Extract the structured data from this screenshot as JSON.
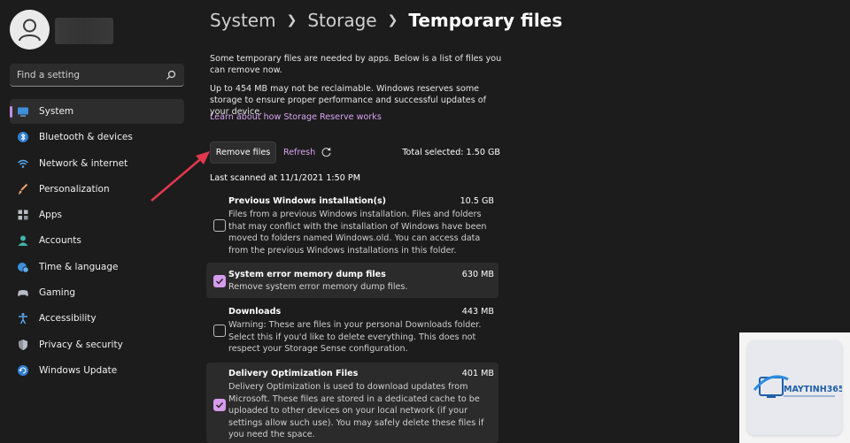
{
  "sidebar": {
    "search_placeholder": "Find a setting",
    "items": [
      {
        "label": "System",
        "icon": "monitor-icon"
      },
      {
        "label": "Bluetooth & devices",
        "icon": "bluetooth-icon"
      },
      {
        "label": "Network & internet",
        "icon": "wifi-icon"
      },
      {
        "label": "Personalization",
        "icon": "brush-icon"
      },
      {
        "label": "Apps",
        "icon": "apps-icon"
      },
      {
        "label": "Accounts",
        "icon": "person-icon"
      },
      {
        "label": "Time & language",
        "icon": "globe-clock-icon"
      },
      {
        "label": "Gaming",
        "icon": "gamepad-icon"
      },
      {
        "label": "Accessibility",
        "icon": "accessibility-icon"
      },
      {
        "label": "Privacy & security",
        "icon": "shield-icon"
      },
      {
        "label": "Windows Update",
        "icon": "update-icon"
      }
    ]
  },
  "breadcrumb": {
    "root": "System",
    "middle": "Storage",
    "current": "Temporary files"
  },
  "intro_text": "Some temporary files are needed by apps. Below is a list of files you can remove now.",
  "reserve_text": "Up to 454 MB may not be reclaimable. Windows reserves some storage to ensure proper performance and successful updates of your device.",
  "learn_link": "Learn about how Storage Reserve works",
  "actions": {
    "remove_label": "Remove files",
    "refresh_label": "Refresh",
    "total_selected": "Total selected: 1.50 GB"
  },
  "last_scanned": "Last scanned at 11/1/2021 1:50 PM",
  "files": [
    {
      "title": "Previous Windows installation(s)",
      "size": "10.5 GB",
      "checked": false,
      "desc": "Files from a previous Windows installation.  Files and folders that may conflict with the installation of Windows have been moved to folders named Windows.old.  You can access data from the previous Windows installations in this folder."
    },
    {
      "title": "System error memory dump files",
      "size": "630 MB",
      "checked": true,
      "desc": "Remove system error memory dump files."
    },
    {
      "title": "Downloads",
      "size": "443 MB",
      "checked": false,
      "desc": "Warning: These are files in your personal Downloads folder. Select this if you'd like to delete everything. This does not respect your Storage Sense configuration."
    },
    {
      "title": "Delivery Optimization Files",
      "size": "401 MB",
      "checked": true,
      "desc": "Delivery Optimization is used to download updates from Microsoft. These files are stored in a dedicated cache to be uploaded to other devices on your local network (if your settings allow such use). You may safely delete these files if you need the space."
    }
  ],
  "watermark": {
    "brand": "MAYTINH365"
  },
  "colors": {
    "accent": "#d9a4f2",
    "checkbox": "#d79bec",
    "arrow": "#e0384e",
    "background": "#1c1c1c"
  }
}
